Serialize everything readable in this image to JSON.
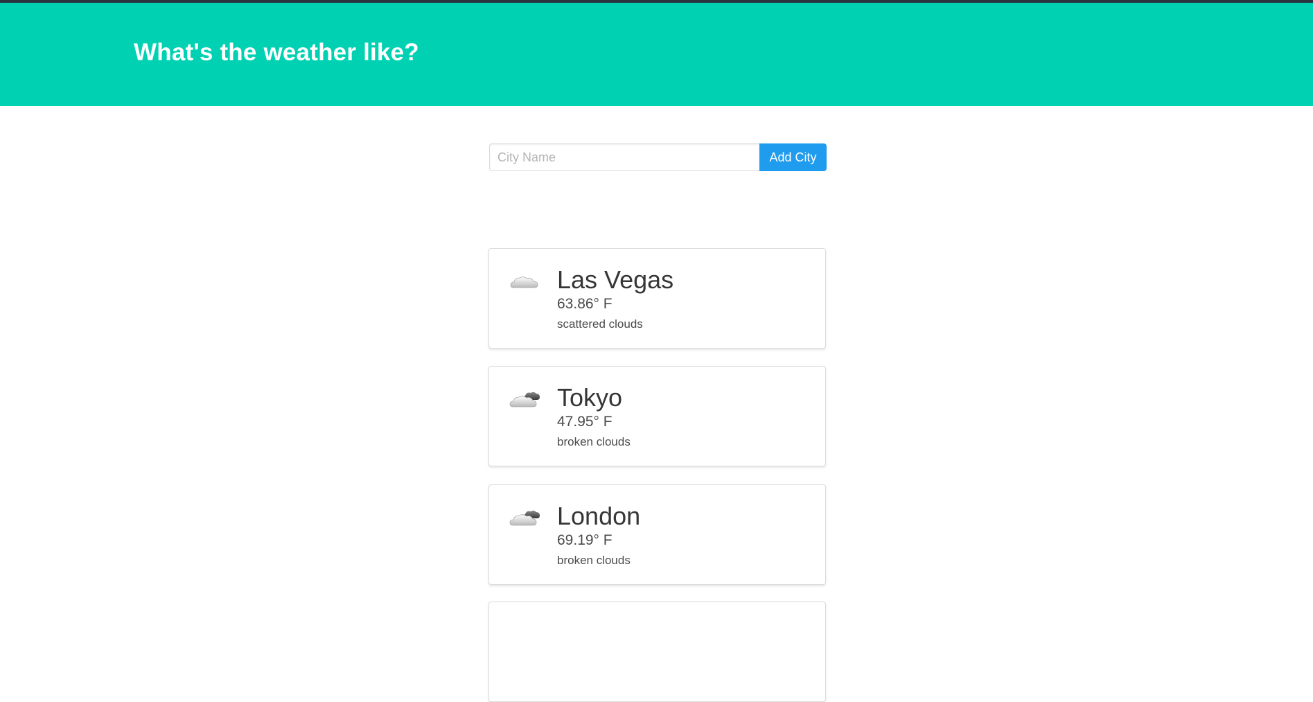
{
  "header": {
    "title": "What's the weather like?",
    "background_color": "#00d1b2"
  },
  "search": {
    "placeholder": "City Name",
    "value": "",
    "button_label": "Add City",
    "button_color": "#209cee"
  },
  "cities": [
    {
      "name": "Las Vegas",
      "temperature": "63.86° F",
      "description": "scattered clouds",
      "icon": "scattered-clouds-icon"
    },
    {
      "name": "Tokyo",
      "temperature": "47.95° F",
      "description": "broken clouds",
      "icon": "broken-clouds-icon"
    },
    {
      "name": "London",
      "temperature": "69.19° F",
      "description": "broken clouds",
      "icon": "broken-clouds-icon"
    }
  ]
}
